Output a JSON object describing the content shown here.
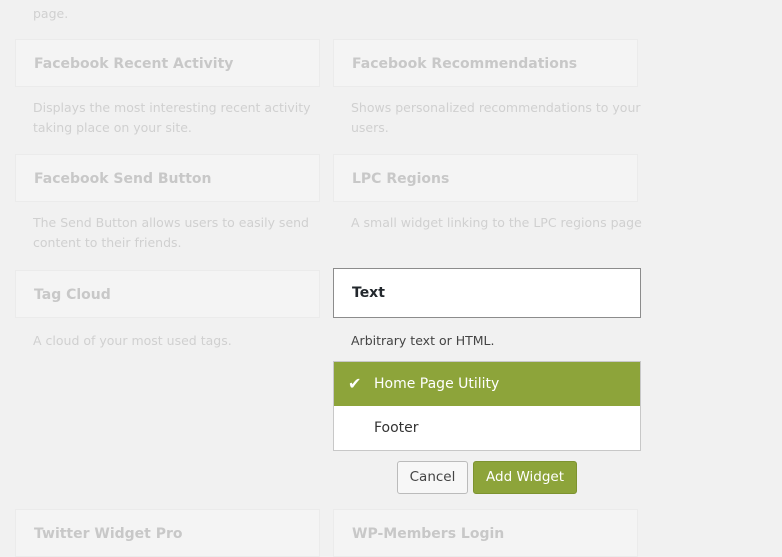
{
  "top_fragment": "page.",
  "widgets": [
    {
      "title": "Facebook Recent Activity",
      "desc": "Displays the most interesting recent activity taking place on your site."
    },
    {
      "title": "Facebook Recommendations",
      "desc": "Shows personalized recommendations to your users."
    },
    {
      "title": "Facebook Send Button",
      "desc": "The Send Button allows users to easily send content to their friends."
    },
    {
      "title": "LPC Regions",
      "desc": "A small widget linking to the LPC regions page"
    },
    {
      "title": "Tag Cloud",
      "desc": "A cloud of your most used tags."
    },
    {
      "title": "Twitter Widget Pro",
      "desc": ""
    },
    {
      "title": "WP-Members Login",
      "desc": ""
    }
  ],
  "active_widget": {
    "title": "Text",
    "desc": "Arbitrary text or HTML.",
    "areas": [
      {
        "label": "Home Page Utility",
        "selected": true
      },
      {
        "label": "Footer",
        "selected": false
      }
    ],
    "check_glyph": "✔",
    "cancel_label": "Cancel",
    "add_label": "Add Widget"
  },
  "colors": {
    "accent": "#8da43a",
    "page_bg": "#f1f1f1"
  }
}
